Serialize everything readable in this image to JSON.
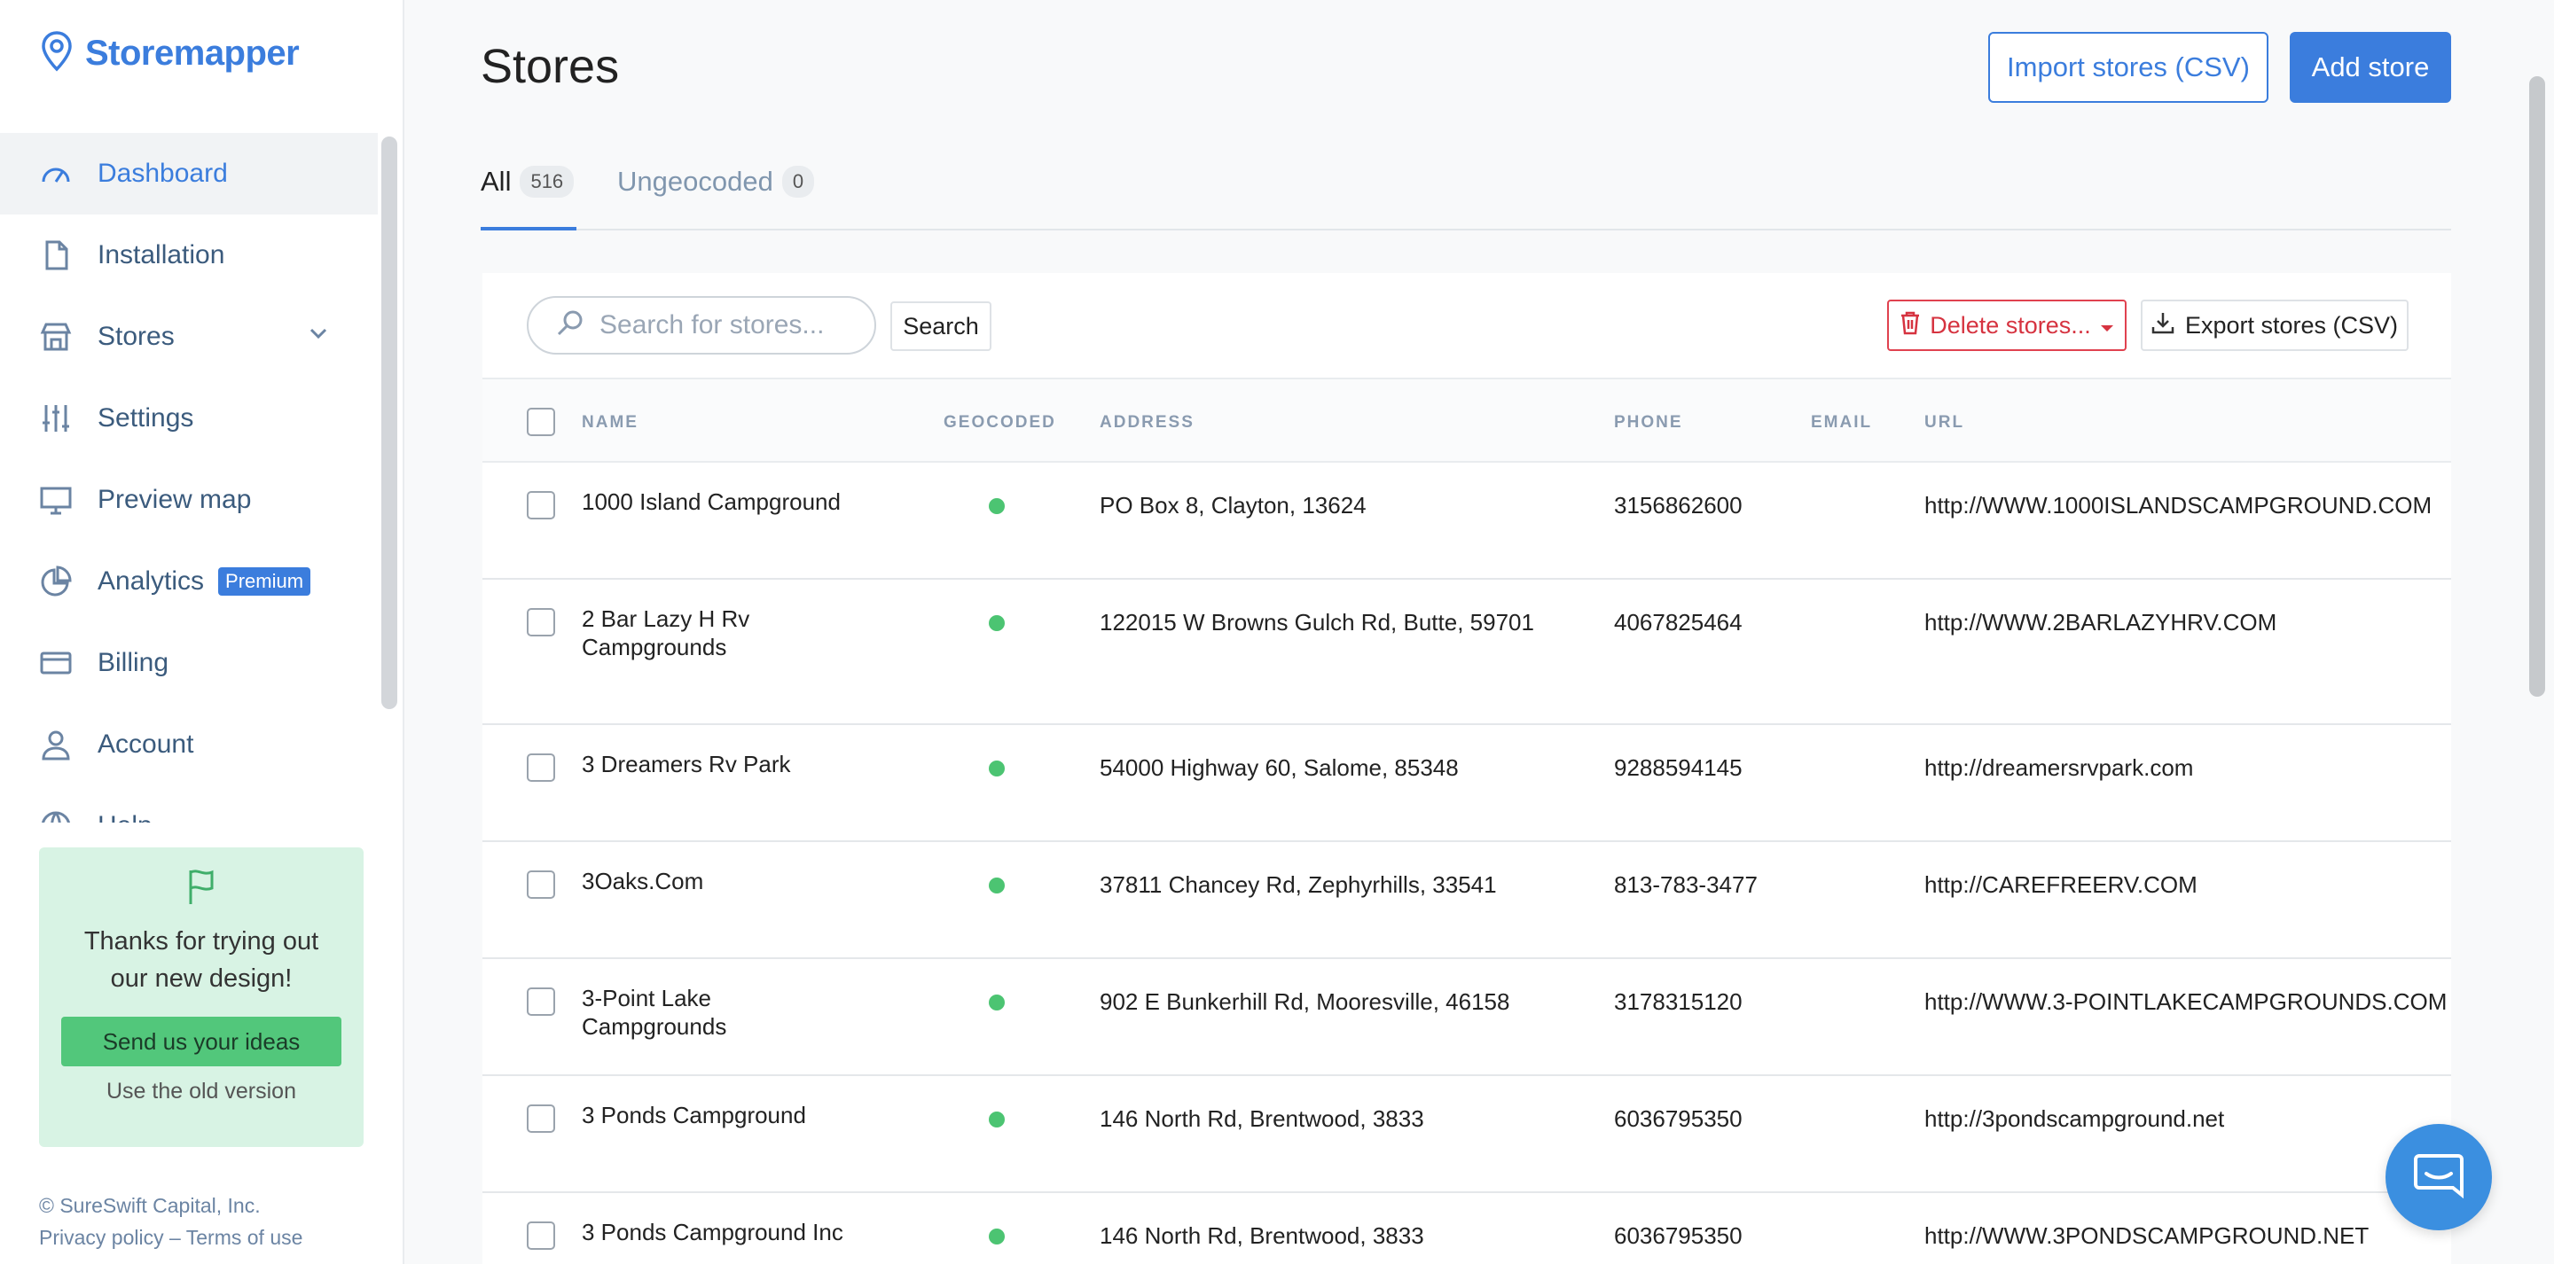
{
  "brand": {
    "name": "Storemapper"
  },
  "sidebar": {
    "items": [
      {
        "label": "Dashboard"
      },
      {
        "label": "Installation"
      },
      {
        "label": "Stores"
      },
      {
        "label": "Settings"
      },
      {
        "label": "Preview map"
      },
      {
        "label": "Analytics",
        "badge": "Premium"
      },
      {
        "label": "Billing"
      },
      {
        "label": "Account"
      },
      {
        "label": "Help"
      }
    ],
    "promo": {
      "title": "Thanks for trying out our new design!",
      "button": "Send us your ideas",
      "link": "Use the old version"
    },
    "footer": {
      "copyright": "© SureSwift Capital, Inc.",
      "links": "Privacy policy – Terms of use"
    }
  },
  "header": {
    "title": "Stores",
    "import_label": "Import stores (CSV)",
    "add_label": "Add store"
  },
  "tabs": [
    {
      "label": "All",
      "count": "516"
    },
    {
      "label": "Ungeocoded",
      "count": "0"
    }
  ],
  "toolbar": {
    "search_placeholder": "Search for stores...",
    "search_button": "Search",
    "delete_label": "Delete stores...",
    "export_label": "Export stores (CSV)"
  },
  "table": {
    "columns": [
      "NAME",
      "GEOCODED",
      "ADDRESS",
      "PHONE",
      "EMAIL",
      "URL"
    ],
    "rows": [
      {
        "name": "1000 Island Campground",
        "address": "PO Box 8, Clayton, 13624",
        "phone": "3156862600",
        "email": "",
        "url": "http://WWW.1000ISLANDSCAMPGROUND.COM"
      },
      {
        "name": "2 Bar Lazy H Rv Campgrounds",
        "address": "122015 W Browns Gulch Rd, Butte, 59701",
        "phone": "4067825464",
        "email": "",
        "url": "http://WWW.2BARLAZYHRV.COM"
      },
      {
        "name": "3 Dreamers Rv Park",
        "address": "54000 Highway 60, Salome, 85348",
        "phone": "9288594145",
        "email": "",
        "url": "http://dreamersrvpark.com"
      },
      {
        "name": "3Oaks.Com",
        "address": "37811 Chancey Rd, Zephyrhills, 33541",
        "phone": "813-783-3477",
        "email": "",
        "url": "http://CAREFREERV.COM"
      },
      {
        "name": "3-Point Lake Campgrounds",
        "address": "902 E Bunkerhill Rd, Mooresville, 46158",
        "phone": "3178315120",
        "email": "",
        "url": "http://WWW.3-POINTLAKECAMPGROUNDS.COM"
      },
      {
        "name": "3 Ponds Campground",
        "address": "146 North Rd, Brentwood, 3833",
        "phone": "6036795350",
        "email": "",
        "url": "http://3pondscampground.net"
      },
      {
        "name": "3 Ponds Campground Inc",
        "address": "146 North Rd, Brentwood, 3833",
        "phone": "6036795350",
        "email": "",
        "url": "http://WWW.3PONDSCAMPGROUND.NET"
      }
    ]
  },
  "colors": {
    "accent": "#3b7ddd",
    "danger": "#d63340",
    "geocoded": "#4cc472",
    "promo_bg": "#d8f3e4"
  }
}
